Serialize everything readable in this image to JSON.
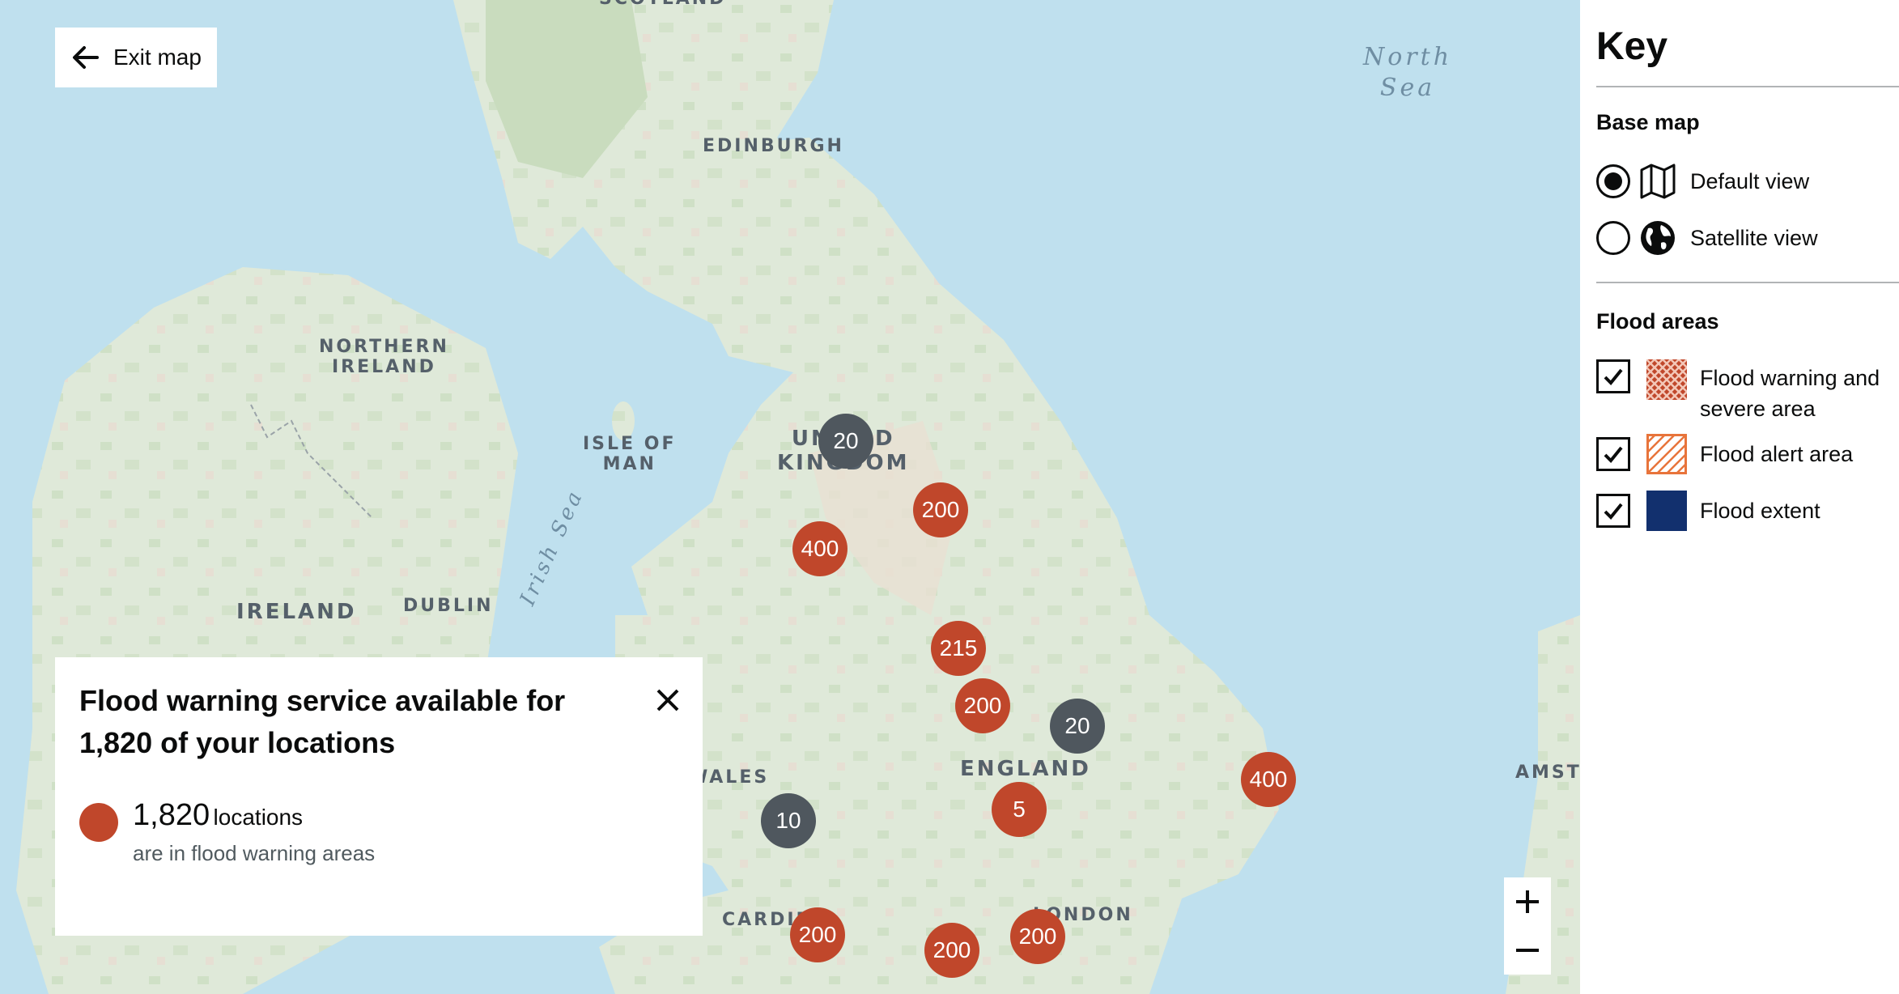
{
  "map": {
    "exit_label": "Exit map",
    "places": [
      {
        "id": "scotland",
        "label": "SCOTLAND"
      },
      {
        "id": "edinburgh",
        "label": "EDINBURGH"
      },
      {
        "id": "northern-ireland",
        "label": "NORTHERN\nIRELAND"
      },
      {
        "id": "isle-of-man",
        "label": "ISLE OF\nMAN"
      },
      {
        "id": "united-kingdom",
        "label": "UNITED\nKINGDOM"
      },
      {
        "id": "ireland",
        "label": "IRELAND"
      },
      {
        "id": "dublin",
        "label": "DUBLIN"
      },
      {
        "id": "wales",
        "label": "WALES"
      },
      {
        "id": "england",
        "label": "ENGLAND"
      },
      {
        "id": "cardiff",
        "label": "CARDIFF"
      },
      {
        "id": "london",
        "label": "LONDON"
      },
      {
        "id": "amsterdam",
        "label": "AMST"
      }
    ],
    "seas": [
      {
        "id": "north-sea",
        "label": "North\nSea"
      },
      {
        "id": "irish-sea",
        "label": "Irish Sea"
      }
    ],
    "clusters": [
      {
        "value": "20",
        "status": "no-warning"
      },
      {
        "value": "200",
        "status": "warning"
      },
      {
        "value": "400",
        "status": "warning"
      },
      {
        "value": "215",
        "status": "warning"
      },
      {
        "value": "200",
        "status": "warning"
      },
      {
        "value": "20",
        "status": "no-warning"
      },
      {
        "value": "400",
        "status": "warning"
      },
      {
        "value": "5",
        "status": "warning"
      },
      {
        "value": "10",
        "status": "no-warning"
      },
      {
        "value": "200",
        "status": "warning"
      },
      {
        "value": "200",
        "status": "warning"
      },
      {
        "value": "200",
        "status": "warning"
      }
    ],
    "zoom_in": "+",
    "zoom_out": "−"
  },
  "panel": {
    "title": "Flood warning service available for 1,820 of your locations",
    "count": "1,820",
    "unit": "locations",
    "description": "are in flood warning areas"
  },
  "key": {
    "title": "Key",
    "base_map_heading": "Base map",
    "base_map_options": [
      {
        "label": "Default view",
        "icon": "map-icon",
        "selected": true
      },
      {
        "label": "Satellite view",
        "icon": "globe-icon",
        "selected": false
      }
    ],
    "flood_areas_heading": "Flood areas",
    "flood_areas": [
      {
        "label": "Flood warning and severe area",
        "checked": true
      },
      {
        "label": "Flood alert area",
        "checked": true
      },
      {
        "label": "Flood extent",
        "checked": true
      }
    ]
  },
  "colors": {
    "sea": "#bfe0ee",
    "land": "#dfe9d9",
    "warning_cluster": "#c0472b",
    "no_warning_cluster": "#4f575e",
    "flood_extent": "#12306e",
    "flood_alert": "#e8743b"
  }
}
